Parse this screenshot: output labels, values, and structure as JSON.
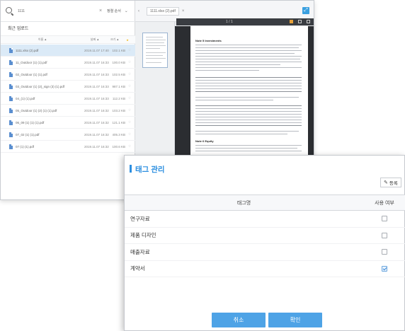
{
  "browser": {
    "search": {
      "value": "1111"
    },
    "sort_label": "정렬 순서",
    "folder_title": "최근 업로드",
    "columns": {
      "name": "이름 ▲",
      "date": "날짜 ▲",
      "size": "크기 ▲",
      "star": "★"
    },
    "files": [
      {
        "name": "1111.xlsx (2).pdf",
        "date": "2019.11.07 17:40",
        "size": "102.1 KB",
        "selected": true
      },
      {
        "name": "11_Outdoor (1) (1).pdf",
        "date": "2019.11.07 16:33",
        "size": "100.0 KB",
        "selected": false
      },
      {
        "name": "02_Outdoor (1) (1).pdf",
        "date": "2019.11.07 16:33",
        "size": "102.5 KB",
        "selected": false
      },
      {
        "name": "03_Outdoor (1) (2)_sign (3) (1).pdf",
        "date": "2019.11.07 16:33",
        "size": "987.1 KB",
        "selected": false
      },
      {
        "name": "04_(1) (1).pdf",
        "date": "2019.11.07 16:33",
        "size": "112.2 KB",
        "selected": false
      },
      {
        "name": "05_Outdoor (1) (2) (1) (1).pdf",
        "date": "2019.11.07 16:32",
        "size": "103.2 KB",
        "selected": false
      },
      {
        "name": "06_09 (1) (1) (1).pdf",
        "date": "2019.11.07 16:32",
        "size": "121.1 KB",
        "selected": false
      },
      {
        "name": "07_02 (1) (1).pdf",
        "date": "2019.11.07 16:32",
        "size": "405.3 KB",
        "selected": false
      },
      {
        "name": "07 (1) (1).pdf",
        "date": "2019.11.07 16:32",
        "size": "100.6 KB",
        "selected": false
      }
    ],
    "viewer": {
      "tab_label": "1111.xlsx (2).pdf",
      "page_indicator": "1 / 1",
      "doc_heading_1": "Note 5 Investments",
      "doc_heading_2": "Note 6 Equity"
    }
  },
  "modal": {
    "title": "태그 관리",
    "add_label": "등록",
    "columns": {
      "tag_name": "태그명",
      "in_use": "사용 여부"
    },
    "tags": [
      {
        "name": "연구자료",
        "checked": false
      },
      {
        "name": "제품 디자인",
        "checked": false
      },
      {
        "name": "매출자료",
        "checked": false
      },
      {
        "name": "계약서",
        "checked": true
      }
    ],
    "cancel_label": "취소",
    "confirm_label": "확인"
  },
  "colors": {
    "accent": "#2d8fe0",
    "button": "#4ea3e6",
    "selected_row": "#dbeaf7"
  }
}
